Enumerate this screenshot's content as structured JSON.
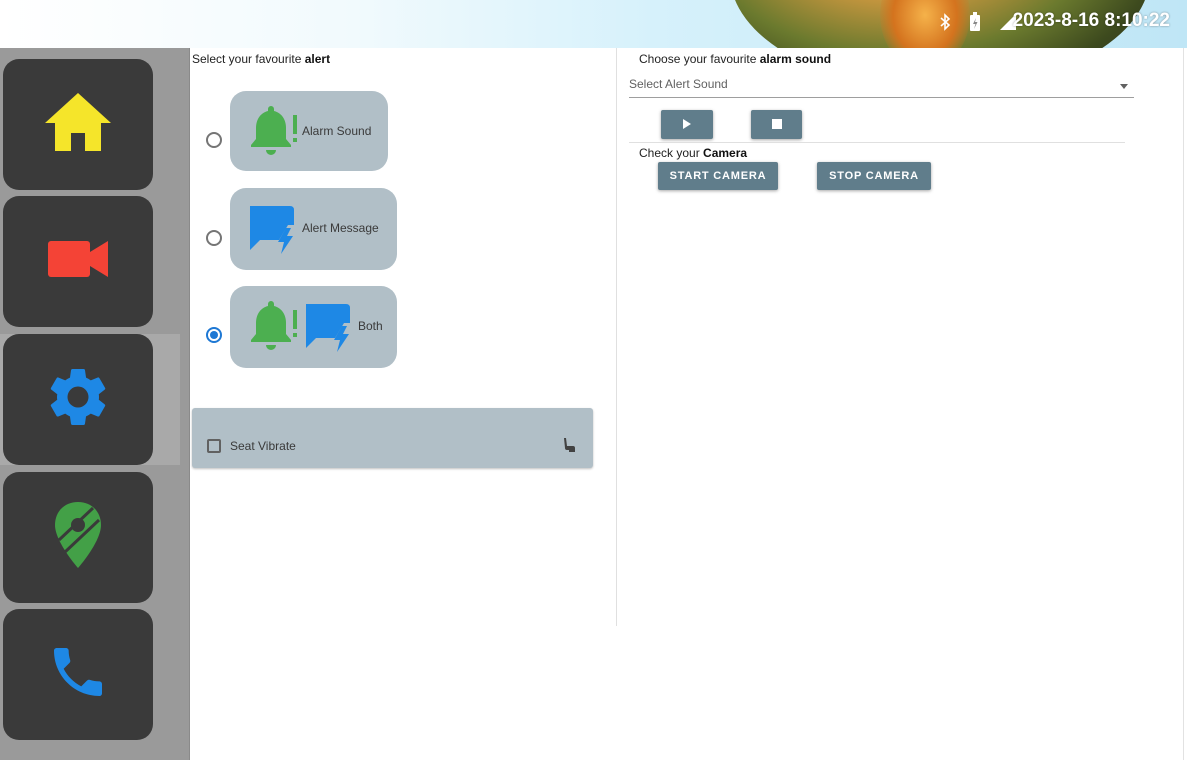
{
  "status_bar": {
    "time": "2023-8-16 8:10:22",
    "icons": [
      "bluetooth-icon",
      "battery-charging-icon",
      "cellular-signal-icon"
    ]
  },
  "sidebar": {
    "items": [
      {
        "name": "home",
        "icon": "home-icon",
        "color": "#f5e52a"
      },
      {
        "name": "camera",
        "icon": "video-camera-icon",
        "color": "#f44336"
      },
      {
        "name": "settings",
        "icon": "gear-icon",
        "color": "#1e88e5",
        "selected": true
      },
      {
        "name": "map",
        "icon": "map-pin-icon",
        "color": "#43a047"
      },
      {
        "name": "phone",
        "icon": "phone-icon",
        "color": "#1e88e5"
      }
    ]
  },
  "alert": {
    "heading_prefix": "Select your favourite ",
    "heading_bold": "alert",
    "options": [
      {
        "label": "Alarm Sound",
        "icons": [
          "bell-alert-icon"
        ],
        "selected": false
      },
      {
        "label": "Alert Message",
        "icons": [
          "message-alert-icon"
        ],
        "selected": false
      },
      {
        "label": "Both",
        "icons": [
          "bell-alert-icon",
          "message-alert-icon"
        ],
        "selected": true
      }
    ],
    "vibrate_label": "Seat Vibrate",
    "vibrate_checked": false
  },
  "sound": {
    "heading_prefix": "Choose your favourite ",
    "heading_bold": "alarm sound",
    "select_placeholder": "Select Alert Sound",
    "play_icon": "play-icon",
    "stop_icon": "stop-icon"
  },
  "camera": {
    "heading_prefix": "Check your ",
    "heading_bold": "Camera",
    "start_label": "START CAMERA",
    "stop_label": "STOP CAMERA"
  },
  "colors": {
    "sidebar_bg": "#9a9a9a",
    "tile_bg": "#3a3a3a",
    "card_bg": "#b1bfc7",
    "button_bg": "#607d8b",
    "radio_selected": "#1e78d4",
    "bell_green": "#4caf50",
    "message_blue": "#1e88e5"
  }
}
